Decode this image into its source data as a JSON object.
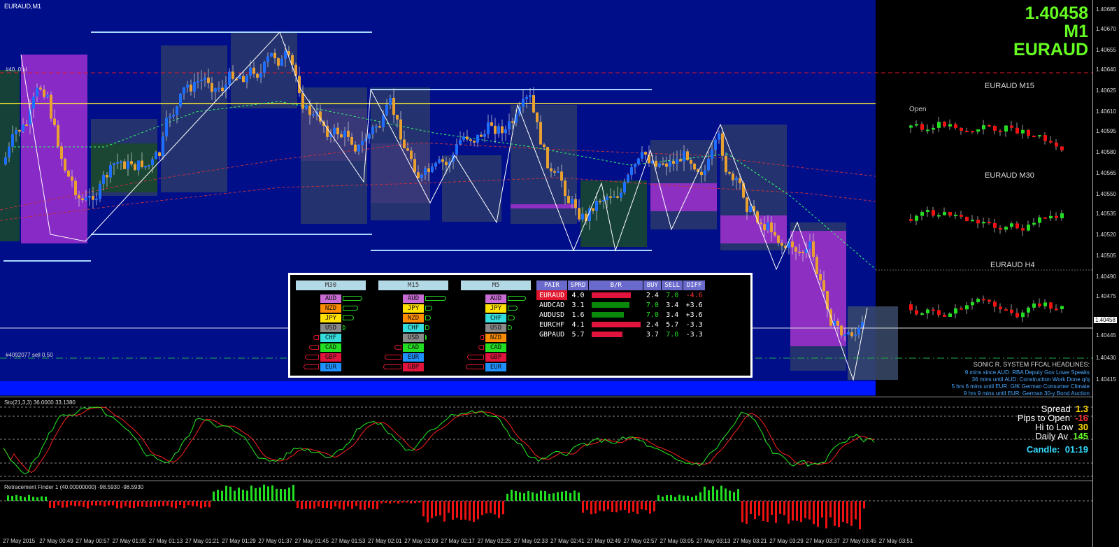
{
  "chart": {
    "title": "EURAUD,M1",
    "current_price": "1.40458",
    "timeframe": "M1",
    "symbol": "EURAUD",
    "trade_labels": [
      "#4092077 sell 0.50",
      "#40..0 sl"
    ],
    "open_label": "Open",
    "mini_charts": [
      "EURAUD M15",
      "EURAUD M30",
      "EURAUD H4"
    ],
    "price_ticks": [
      "1.40685",
      "1.40670",
      "1.40655",
      "1.40640",
      "1.40625",
      "1.40610",
      "1.40595",
      "1.40580",
      "1.40565",
      "1.40550",
      "1.40535",
      "1.40520",
      "1.40505",
      "1.40490",
      "1.40475",
      "1.40458",
      "1.40445",
      "1.40430",
      "1.40415"
    ],
    "price_highlight": "1.40458"
  },
  "strength_panel": {
    "columns": [
      {
        "header": "M30",
        "items": [
          {
            "cur": "AUD",
            "color": "#c86bd4",
            "side": "right",
            "len": 28
          },
          {
            "cur": "NZD",
            "color": "#ff8c00",
            "side": "right",
            "len": 22
          },
          {
            "cur": "JPY",
            "color": "#ffe000",
            "side": "right",
            "len": 16
          },
          {
            "cur": "USD",
            "color": "#8a8a8a",
            "side": "right",
            "len": 4
          },
          {
            "cur": "CHF",
            "color": "#33dddd",
            "side": "left",
            "len": 8
          },
          {
            "cur": "CAD",
            "color": "#22dd22",
            "side": "left",
            "len": 14
          },
          {
            "cur": "GBP",
            "color": "#e0143c",
            "side": "left",
            "len": 20
          },
          {
            "cur": "EUR",
            "color": "#1e90ff",
            "side": "left",
            "len": 22
          }
        ]
      },
      {
        "header": "M15",
        "items": [
          {
            "cur": "AUD",
            "color": "#c86bd4",
            "side": "right",
            "len": 30
          },
          {
            "cur": "JPY",
            "color": "#ffe000",
            "side": "right",
            "len": 10
          },
          {
            "cur": "NZD",
            "color": "#ff8c00",
            "side": "right",
            "len": 8
          },
          {
            "cur": "CHF",
            "color": "#33dddd",
            "side": "right",
            "len": 6
          },
          {
            "cur": "USD",
            "color": "#8a8a8a",
            "side": "right",
            "len": 2
          },
          {
            "cur": "CAD",
            "color": "#22dd22",
            "side": "left",
            "len": 10
          },
          {
            "cur": "EUR",
            "color": "#1e90ff",
            "side": "left",
            "len": 24
          },
          {
            "cur": "GBP",
            "color": "#e0143c",
            "side": "left",
            "len": 26
          }
        ]
      },
      {
        "header": "M5",
        "items": [
          {
            "cur": "AUD",
            "color": "#c86bd4",
            "side": "right",
            "len": 26
          },
          {
            "cur": "JPY",
            "color": "#ffe000",
            "side": "right",
            "len": 14
          },
          {
            "cur": "CHF",
            "color": "#33dddd",
            "side": "right",
            "len": 10
          },
          {
            "cur": "USD",
            "color": "#8a8a8a",
            "side": "right",
            "len": 6
          },
          {
            "cur": "NZD",
            "color": "#ff8c00",
            "side": "left",
            "len": 6
          },
          {
            "cur": "CAD",
            "color": "#22dd22",
            "side": "left",
            "len": 8
          },
          {
            "cur": "GBP",
            "color": "#e0143c",
            "side": "left",
            "len": 24
          },
          {
            "cur": "EUR",
            "color": "#1e90ff",
            "side": "left",
            "len": 26
          }
        ]
      }
    ],
    "table": {
      "headers": [
        "PAIR",
        "SPRD",
        "B/R",
        "BUY",
        "SELL",
        "DIFF"
      ],
      "rows": [
        {
          "pair": "EURAUD",
          "sprd": "4.0",
          "br_color": "#e0143c",
          "br_len": 56,
          "buy": "2.4",
          "buy_color": "#ffffff",
          "sell": "7.0",
          "sell_color": "#22dd22",
          "diff": "-4.6",
          "diff_color": "#ff3030",
          "highlight": true
        },
        {
          "pair": "AUDCAD",
          "sprd": "3.1",
          "br_color": "#0a8a0a",
          "br_len": 54,
          "buy": "7.0",
          "buy_color": "#22dd22",
          "sell": "3.4",
          "sell_color": "#ffffff",
          "diff": "+3.6",
          "diff_color": "#ffffff",
          "highlight": false
        },
        {
          "pair": "AUDUSD",
          "sprd": "1.6",
          "br_color": "#0a8a0a",
          "br_len": 46,
          "buy": "7.0",
          "buy_color": "#22dd22",
          "sell": "3.4",
          "sell_color": "#ffffff",
          "diff": "+3.6",
          "diff_color": "#ffffff",
          "highlight": false
        },
        {
          "pair": "EURCHF",
          "sprd": "4.1",
          "br_color": "#e0143c",
          "br_len": 70,
          "buy": "2.4",
          "buy_color": "#ffffff",
          "sell": "5.7",
          "sell_color": "#ffffff",
          "diff": "-3.3",
          "diff_color": "#ffffff",
          "highlight": false
        },
        {
          "pair": "GBPAUD",
          "sprd": "5.7",
          "br_color": "#e0143c",
          "br_len": 44,
          "buy": "3.7",
          "buy_color": "#ffffff",
          "sell": "7.0",
          "sell_color": "#22dd22",
          "diff": "-3.3",
          "diff_color": "#ffffff",
          "highlight": false
        }
      ]
    }
  },
  "headlines": {
    "title": "SONIC R. SYSTEM  FFCAL HEADLINES:",
    "items": [
      "9 mins since AUD: RBA Deputy Gov Lowe Speaks",
      "36 mins until AUD: Construction Work Done q/q",
      "5 hrs 6 mins until EUR: GfK German Consumer Climate",
      "9 hrs 9 mins until EUR: German 30-y Bond Auction"
    ]
  },
  "stats": {
    "spread_label": "Spread",
    "spread_value": "1.3",
    "pips_label": "Pips to Open",
    "pips_value": "-16",
    "hilo_label": "Hi to Low",
    "hilo_value": "30",
    "daily_label": "Daily Av",
    "daily_value": "145",
    "candle_label": "Candle:",
    "candle_value": "01:19"
  },
  "stochastic": {
    "label": "Sto(21,3,3) 36.0000 33.1380",
    "levels": [
      "100",
      "80",
      "50",
      "20",
      "0"
    ]
  },
  "retracement": {
    "label": "Retracement Finder 1 (40.00000000) -98.5930 -98.5930",
    "levels": [
      "178.5225",
      "0.00",
      "-269.7230"
    ]
  },
  "time_axis": [
    "27 May 2015",
    "27 May 00:49",
    "27 May 00:57",
    "27 May 01:05",
    "27 May 01:13",
    "27 May 01:21",
    "27 May 01:29",
    "27 May 01:37",
    "27 May 01:45",
    "27 May 01:53",
    "27 May 02:01",
    "27 May 02:09",
    "27 May 02:17",
    "27 May 02:25",
    "27 May 02:33",
    "27 May 02:41",
    "27 May 02:49",
    "27 May 02:57",
    "27 May 03:05",
    "27 May 03:13",
    "27 May 03:21",
    "27 May 03:29",
    "27 May 03:37",
    "27 May 03:45",
    "27 May 03:51"
  ],
  "colors": {
    "chart_bg": "#000e8a",
    "bull_candle": "#1e6fff",
    "bear_candle": "#e8a030",
    "box_purple": "#a030d0",
    "box_gray": "#2a3a6a",
    "price_green": "#66ff22"
  }
}
